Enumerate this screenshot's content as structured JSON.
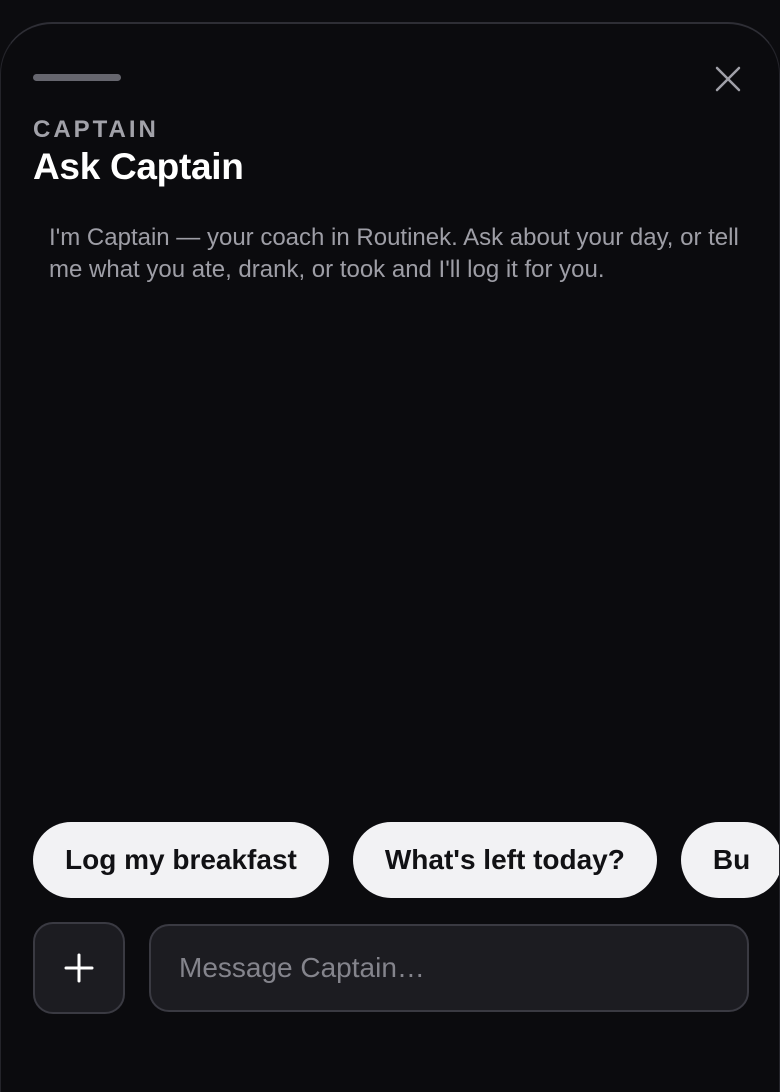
{
  "header": {
    "eyebrow": "CAPTAIN",
    "title": "Ask Captain",
    "close_icon": "close-icon"
  },
  "conversation": {
    "intro_message": "I'm Captain — your coach in Routinek. Ask about your day, or tell me what you ate, drank, or took and I'll log it for you."
  },
  "suggestions": [
    {
      "label": "Log my breakfast"
    },
    {
      "label": "What's left today?"
    },
    {
      "label": "Bu"
    }
  ],
  "composer": {
    "add_icon": "plus-icon",
    "placeholder": "Message Captain…",
    "value": ""
  },
  "colors": {
    "background": "#0b0b0e",
    "chip_background": "#f2f2f4",
    "input_background": "#1c1c21",
    "muted_text": "#9e9ea6"
  }
}
